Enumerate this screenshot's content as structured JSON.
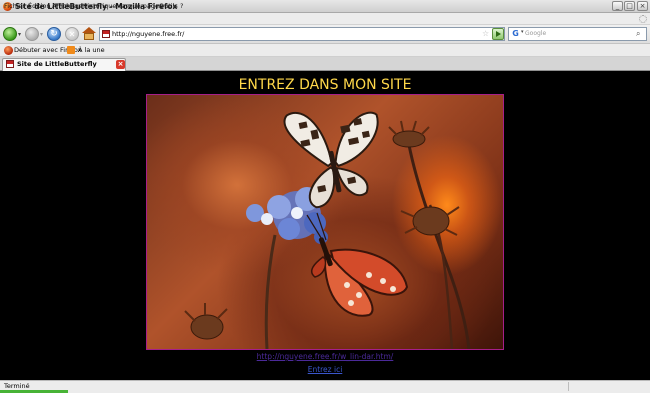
{
  "window": {
    "title": "Site de LittleButterfly - Mozilla Firefox",
    "controls": {
      "minimize": "_",
      "maximize": "□",
      "close": "×"
    }
  },
  "menu": [
    "Fichier",
    "Édition",
    "Affichage",
    "Historique",
    "Marque-pages",
    "Outils",
    "?"
  ],
  "toolbar": {
    "url": "http://nguyene.free.fr/",
    "search_placeholder": "Google",
    "search_engine_letter": "G",
    "icons": [
      "back-arrow-icon",
      "forward-arrow-icon",
      "reload-icon",
      "stop-icon",
      "home-icon",
      "star-icon",
      "go-arrow-icon",
      "magnifier-icon"
    ],
    "glyphs": {
      "dropdown": "▾",
      "reload": "↻",
      "stop": "✕",
      "star": "☆",
      "search": "⌕"
    }
  },
  "bookmarks": [
    {
      "label": "Débuter avec Firefox",
      "icon": "firefox-icon"
    },
    {
      "label": "À la une",
      "icon": "rss-feed-icon"
    }
  ],
  "tabs": [
    {
      "label": "Site de LittleButterfly",
      "active": true,
      "close_glyph": "×"
    }
  ],
  "page": {
    "heading": "ENTREZ DANS MON SITE",
    "image": "butterfly-on-flower-photo",
    "link_url": "http://nguyene.free.fr/w_lin-dar.htm/",
    "link_enter": "Entrez ici"
  },
  "status": {
    "text": "Terminé"
  },
  "colors": {
    "heading": "#ffd84a",
    "photo_border": "#a61f8a",
    "page_bg": "#000000",
    "link_url": "#4b2a99",
    "link_enter": "#3a56cc"
  }
}
